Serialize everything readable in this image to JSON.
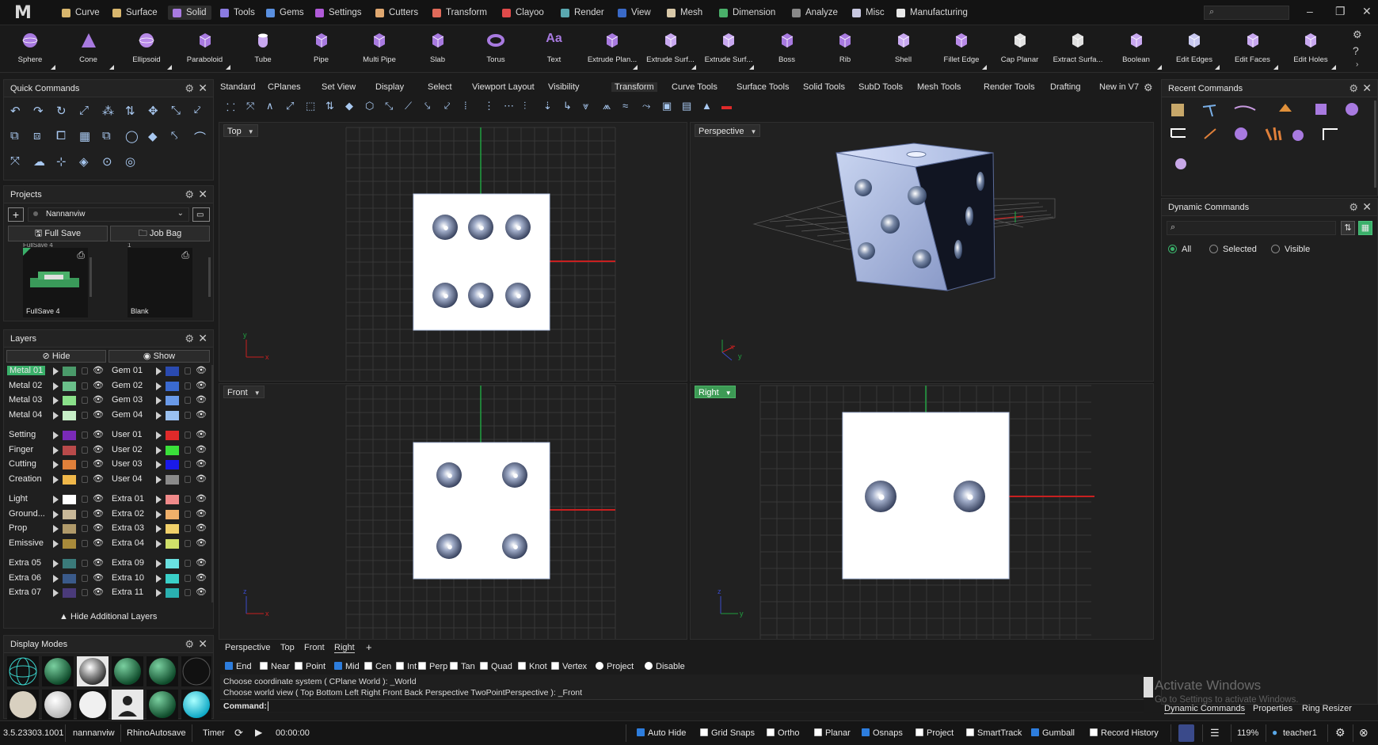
{
  "app": {
    "logo": "M",
    "menu_tabs": [
      {
        "label": "Curve",
        "color": "#d8b66d"
      },
      {
        "label": "Surface",
        "color": "#d8b66d"
      },
      {
        "label": "Solid",
        "color": "#a87ae0"
      },
      {
        "label": "Tools",
        "color": "#8a7ae0"
      },
      {
        "label": "Gems",
        "color": "#5a90e0"
      },
      {
        "label": "Settings",
        "color": "#b05ad8"
      },
      {
        "label": "Cutters",
        "color": "#e0a870"
      },
      {
        "label": "Transform",
        "color": "#e06a5a"
      },
      {
        "label": "Clayoo",
        "color": "#e04a4a"
      },
      {
        "label": "Render",
        "color": "#5aa8b0"
      },
      {
        "label": "View",
        "color": "#3a6ac8"
      },
      {
        "label": "Mesh",
        "color": "#d8c8a8"
      },
      {
        "label": "Dimension",
        "color": "#4ab06a"
      },
      {
        "label": "Analyze",
        "color": "#888888"
      },
      {
        "label": "Misc",
        "color": "#c8c8e0"
      },
      {
        "label": "Manufacturing",
        "color": "#e8e8e8"
      }
    ],
    "active_menu_tab": "Solid",
    "search_placeholder": "⌕"
  },
  "ribbon": {
    "buttons": [
      {
        "label": "Sphere",
        "icon": "sphere-icon",
        "arrow": true
      },
      {
        "label": "Cone",
        "icon": "cone-icon",
        "arrow": true
      },
      {
        "label": "Ellipsoid",
        "icon": "ellipsoid-icon",
        "arrow": true
      },
      {
        "label": "Paraboloid",
        "icon": "paraboloid-icon",
        "arrow": true
      },
      {
        "label": "Tube",
        "icon": "tube-icon",
        "arrow": false
      },
      {
        "label": "Pipe",
        "icon": "pipe-icon",
        "arrow": false
      },
      {
        "label": "Multi Pipe",
        "icon": "multi-pipe-icon",
        "arrow": false
      },
      {
        "label": "Slab",
        "icon": "slab-icon",
        "arrow": false
      },
      {
        "label": "Torus",
        "icon": "torus-icon",
        "arrow": false
      },
      {
        "label": "Text",
        "icon": "text-icon",
        "arrow": false
      },
      {
        "label": "Extrude Plan...",
        "icon": "extrude-planar-icon",
        "arrow": true
      },
      {
        "label": "Extrude Surf...",
        "icon": "extrude-surface-icon",
        "arrow": true
      },
      {
        "label": "Extrude Surf...",
        "icon": "extrude-surface-2-icon",
        "arrow": true
      },
      {
        "label": "Boss",
        "icon": "boss-icon",
        "arrow": false
      },
      {
        "label": "Rib",
        "icon": "rib-icon",
        "arrow": false
      },
      {
        "label": "Shell",
        "icon": "shell-icon",
        "arrow": false
      },
      {
        "label": "Fillet Edge",
        "icon": "fillet-edge-icon",
        "arrow": true
      },
      {
        "label": "Cap Planar",
        "icon": "cap-planar-icon",
        "arrow": false
      },
      {
        "label": "Extract Surfa...",
        "icon": "extract-surface-icon",
        "arrow": false
      },
      {
        "label": "Boolean",
        "icon": "boolean-icon",
        "arrow": true
      },
      {
        "label": "Edit Edges",
        "icon": "edit-edges-icon",
        "arrow": true
      },
      {
        "label": "Edit Faces",
        "icon": "edit-faces-icon",
        "arrow": true
      },
      {
        "label": "Edit Holes",
        "icon": "edit-holes-icon",
        "arrow": true
      }
    ]
  },
  "quick_commands": {
    "title": "Quick Commands"
  },
  "projects": {
    "title": "Projects",
    "dropdown_value": "Nannanviw",
    "full_save": "Full Save",
    "job_bag": "Job Bag",
    "thumb1": "FullSave 4",
    "thumb2": "Blank",
    "thumb1_top": "FullSave 4",
    "thumb2_top": "1"
  },
  "layers": {
    "title": "Layers",
    "hide_label": "Hide",
    "show_label": "Show",
    "left": [
      {
        "name": "Metal 01",
        "color": "#4a9a6a",
        "active": true
      },
      {
        "name": "Metal 02",
        "color": "#6abf8a"
      },
      {
        "name": "Metal 03",
        "color": "#8ae08a"
      },
      {
        "name": "Metal 04",
        "color": "#c8f0c8"
      },
      {
        "name": "Setting",
        "color": "#7a2ab8",
        "gap": true
      },
      {
        "name": "Finger",
        "color": "#b84a4a"
      },
      {
        "name": "Cutting",
        "color": "#e0803a"
      },
      {
        "name": "Creation",
        "color": "#f0b84a"
      },
      {
        "name": "Light",
        "color": "#ffffff",
        "gap": true
      },
      {
        "name": "Ground...",
        "color": "#c8b898"
      },
      {
        "name": "Prop",
        "color": "#b09a6a"
      },
      {
        "name": "Emissive",
        "color": "#a88a3a"
      },
      {
        "name": "Extra 05",
        "color": "#3a7a7a",
        "gap": true
      },
      {
        "name": "Extra 06",
        "color": "#3a5a8a"
      },
      {
        "name": "Extra 07",
        "color": "#4a3a7a"
      }
    ],
    "right": [
      {
        "name": "Gem 01",
        "color": "#2a4ab0"
      },
      {
        "name": "Gem 02",
        "color": "#3a6ad0"
      },
      {
        "name": "Gem 03",
        "color": "#6a9ae8"
      },
      {
        "name": "Gem 04",
        "color": "#9ac0f0"
      },
      {
        "name": "User 01",
        "color": "#e02a2a",
        "gap": true
      },
      {
        "name": "User 02",
        "color": "#3ae03a"
      },
      {
        "name": "User 03",
        "color": "#1a1ae8"
      },
      {
        "name": "User 04",
        "color": "#8a8a8a"
      },
      {
        "name": "Extra 01",
        "color": "#f08a8a",
        "gap": true
      },
      {
        "name": "Extra 02",
        "color": "#f0b06a"
      },
      {
        "name": "Extra 03",
        "color": "#f0d06a"
      },
      {
        "name": "Extra 04",
        "color": "#d0e06a"
      },
      {
        "name": "Extra 09",
        "color": "#6ae0e0",
        "gap": true
      },
      {
        "name": "Extra 10",
        "color": "#3ad0c8"
      },
      {
        "name": "Extra 11",
        "color": "#2ab0b0"
      }
    ],
    "hide_additional": "Hide Additional Layers"
  },
  "display_modes": {
    "title": "Display Modes"
  },
  "viewport_tabs": [
    "Standard",
    "CPlanes",
    "Set View",
    "Display",
    "Select",
    "Viewport Layout",
    "Visibility",
    "Transform",
    "Curve Tools",
    "Surface Tools",
    "Solid Tools",
    "SubD Tools",
    "Mesh Tools",
    "Render Tools",
    "Drafting",
    "New in V7"
  ],
  "active_viewport_tab": "Transform",
  "viewports": {
    "top": "Top",
    "perspective": "Perspective",
    "front": "Front",
    "right": "Right"
  },
  "bottom_tabs": [
    "Perspective",
    "Top",
    "Front",
    "Right"
  ],
  "bottom_tab_add": "+",
  "osnaps": [
    {
      "label": "End",
      "checked": true
    },
    {
      "label": "Near",
      "checked": false
    },
    {
      "label": "Point",
      "checked": false
    },
    {
      "label": "Mid",
      "checked": true
    },
    {
      "label": "Cen",
      "checked": false
    },
    {
      "label": "Int",
      "checked": false
    },
    {
      "label": "Perp",
      "checked": false
    },
    {
      "label": "Tan",
      "checked": false
    },
    {
      "label": "Quad",
      "checked": false
    },
    {
      "label": "Knot",
      "checked": false
    },
    {
      "label": "Vertex",
      "checked": false
    },
    {
      "label": "Project",
      "checked": false,
      "radio": true
    },
    {
      "label": "Disable",
      "checked": false,
      "radio": true
    }
  ],
  "command": {
    "line1": "Choose coordinate system ( CPlane  World ): _World",
    "line2": "Choose world view ( Top  Bottom  Left  Right  Front  Back  Perspective  TwoPointPerspective ): _Front",
    "prompt": "Command:"
  },
  "recent_commands": {
    "title": "Recent Commands"
  },
  "dynamic_commands": {
    "title": "Dynamic Commands",
    "search_placeholder": "⌕",
    "options": [
      "All",
      "Selected",
      "Visible"
    ],
    "selected": "All"
  },
  "right_bottom_tabs": [
    "Dynamic Commands",
    "Properties",
    "Ring Resizer"
  ],
  "watermark": {
    "title": "Activate Windows",
    "subtitle": "Go to Settings to activate Windows."
  },
  "status": {
    "version": "3.5.23303.1001",
    "user_project": "nannanviw",
    "autosave": "RhinoAutosave",
    "timer_label": "Timer",
    "timer_value": "00:00:00",
    "auto_hide": "Auto Hide",
    "grid_snaps": "Grid Snaps",
    "ortho": "Ortho",
    "planar": "Planar",
    "osnaps": "Osnaps",
    "project": "Project",
    "smarttrack": "SmartTrack",
    "gumball": "Gumball",
    "record_history": "Record History",
    "zoom": "119%",
    "user": "teacher1"
  }
}
